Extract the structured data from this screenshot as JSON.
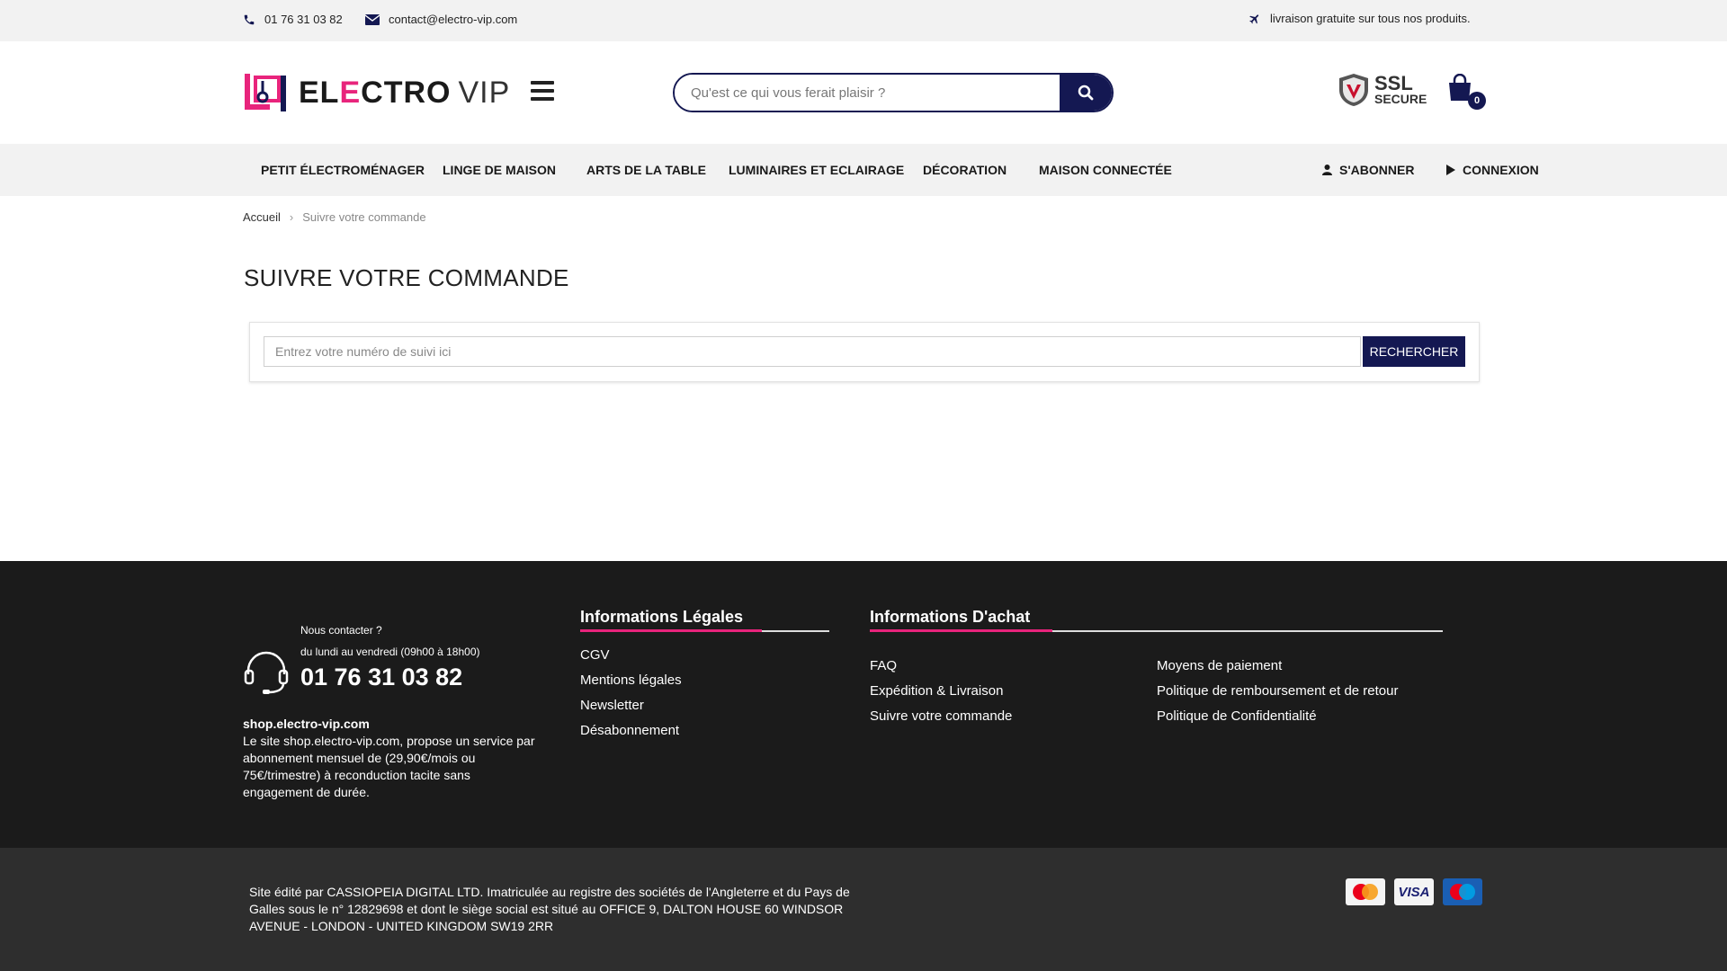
{
  "topbar": {
    "phone": "01 76 31 03 82",
    "email": "contact@electro-vip.com",
    "shipping": "livraison gratuite sur tous nos produits."
  },
  "header": {
    "logo": {
      "part1": "EL",
      "part2": "E",
      "part3": "CTRO",
      "part4": "VIP"
    },
    "search_placeholder": "Qu'est ce qui vous ferait plaisir ?",
    "ssl_line1": "SSL",
    "ssl_line2": "SECURE",
    "cart_count": "0"
  },
  "nav": {
    "items": [
      "PETIT ÉLECTROMÉNAGER",
      "LINGE DE MAISON",
      "ARTS DE LA TABLE",
      "LUMINAIRES ET ECLAIRAGE",
      "DÉCORATION",
      "MAISON CONNECTÉE"
    ],
    "subscribe": "S'ABONNER",
    "login": "CONNEXION"
  },
  "breadcrumb": {
    "home": "Accueil",
    "sep": "›",
    "current": "Suivre votre commande"
  },
  "page": {
    "title": "SUIVRE VOTRE COMMANDE",
    "track_placeholder": "Entrez votre numéro de suivi ici",
    "search_button": "RECHERCHER"
  },
  "footer": {
    "contact_label": "Nous contacter ?",
    "contact_hours": "du lundi au vendredi (09h00 à 18h00)",
    "contact_phone": "01 76 31 03 82",
    "site_name": "shop.electro-vip.com",
    "about_text": "Le site shop.electro-vip.com, propose un service par abonnement mensuel de (29,90€/mois ou 75€/trimestre) à reconduction tacite sans engagement de durée.",
    "legal_title": "Informations Légales",
    "legal_links": [
      "CGV",
      "Mentions légales",
      "Newsletter",
      "Désabonnement"
    ],
    "purchase_title": "Informations D'achat",
    "purchase_links_col1": [
      "FAQ",
      "Expédition & Livraison",
      "Suivre votre commande"
    ],
    "purchase_links_col2": [
      "Moyens de paiement",
      "Politique de remboursement et de retour",
      "Politique de Confidentialité"
    ]
  },
  "bottom": {
    "legal_text": "Site édité par CASSIOPEIA DIGITAL LTD. Imatriculée au registre des sociétés de l'Angleterre et du Pays de Galles sous le n° 12829698 et dont le siège social est situé au OFFICE 9, DALTON HOUSE 60 WINDSOR AVENUE - LONDON - UNITED KINGDOM SW19 2RR",
    "cards": [
      "MasterCard",
      "VISA",
      "Maestro"
    ]
  },
  "colors": {
    "brand_navy": "#141852",
    "brand_pink": "#e8247c",
    "footer_bg": "#1b1b1b",
    "bottom_bg": "#2e2e2e"
  }
}
